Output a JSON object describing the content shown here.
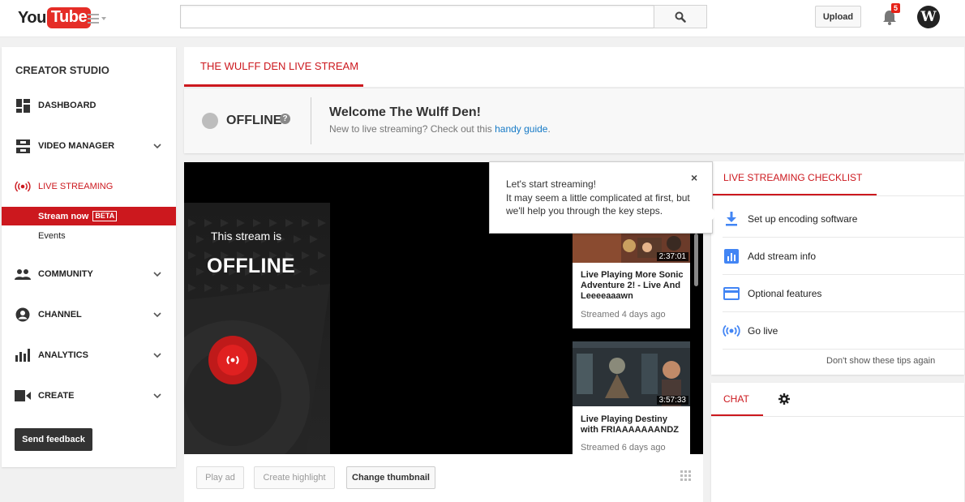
{
  "header": {
    "logo_you": "You",
    "logo_tube": "Tube",
    "search_placeholder": "",
    "upload_label": "Upload",
    "notification_count": "5",
    "avatar_letter": "W"
  },
  "sidebar": {
    "title": "CREATOR STUDIO",
    "items": [
      {
        "label": "DASHBOARD",
        "icon": "dashboard-icon"
      },
      {
        "label": "VIDEO MANAGER",
        "icon": "video-manager-icon"
      },
      {
        "label": "LIVE STREAMING",
        "icon": "live-streaming-icon"
      },
      {
        "label": "COMMUNITY",
        "icon": "community-icon"
      },
      {
        "label": "CHANNEL",
        "icon": "channel-icon"
      },
      {
        "label": "ANALYTICS",
        "icon": "analytics-icon"
      },
      {
        "label": "CREATE",
        "icon": "create-icon"
      }
    ],
    "sub_items": [
      {
        "label": "Stream now",
        "badge": "BETA"
      },
      {
        "label": "Events"
      }
    ],
    "feedback_label": "Send feedback"
  },
  "main": {
    "tab_label": "THE WULFF DEN LIVE STREAM",
    "status": "OFFLINE",
    "help": "?",
    "welcome_title": "Welcome The Wulff Den!",
    "welcome_sub": "New to live streaming? Check out this ",
    "welcome_link": "handy guide",
    "welcome_end": "."
  },
  "player": {
    "line1": "This stream is",
    "line2": "OFFLINE",
    "videos": [
      {
        "title": "Live Playing More Sonic Adventure 2! - Live And Leeeeaaawn",
        "meta": "Streamed 4 days ago",
        "duration": "2:37:01"
      },
      {
        "title": "Live Playing Destiny with FRIAAAAAAANDZ",
        "meta": "Streamed 6 days ago",
        "duration": "3:57:33"
      }
    ],
    "controls": {
      "play_ad": "Play ad",
      "create_highlight": "Create highlight",
      "change_thumbnail": "Change thumbnail"
    }
  },
  "tooltip": {
    "title": "Let's start streaming!",
    "body": "It may seem a little complicated at first, but we'll help you through the key steps.",
    "close": "×"
  },
  "checklist": {
    "title": "LIVE STREAMING CHECKLIST",
    "items": [
      {
        "label": "Set up encoding software",
        "icon": "download-icon"
      },
      {
        "label": "Add stream info",
        "icon": "chart-icon"
      },
      {
        "label": "Optional features",
        "icon": "card-icon"
      },
      {
        "label": "Go live",
        "icon": "broadcast-icon"
      }
    ],
    "dont_show": "Don't show these tips again"
  },
  "chat": {
    "tab_label": "CHAT"
  },
  "colors": {
    "accent": "#cc181e",
    "link": "#167ac6",
    "checklist_icon": "#4285f4"
  }
}
